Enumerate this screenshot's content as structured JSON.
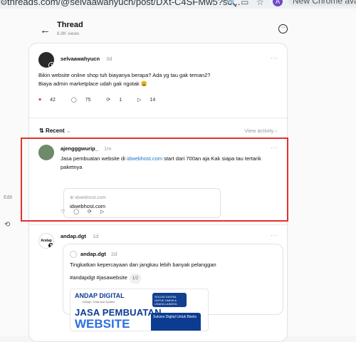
{
  "browser": {
    "url": "threads.com/@selvaawahyucn/post/DXt-C4SFMw5?so...",
    "profile_initial": "A",
    "chrome_chip": "New Chrome ava"
  },
  "sidebar": {
    "edit_label": "Edit"
  },
  "header": {
    "title": "Thread",
    "views": "6.9K views"
  },
  "main_post": {
    "username": "selvaawahyucn",
    "time": "3d",
    "line1": "Bikin website online shop tuh biayanya berapa? Ada yg tau gak teman2?",
    "line2": "Biaya admin marketplace udah gak ngotak 😩",
    "likes": "42",
    "replies": "75",
    "reposts": "1",
    "shares": "14"
  },
  "sort": {
    "label": "Recent",
    "view_activity": "View activity"
  },
  "reply_1": {
    "username": "ajengggwurip_",
    "time": "1m",
    "text_before": "Jasa pembuatan website di ",
    "link_text": "idwebhost.com",
    "text_after": " start dari 700an aja Kak siapa tau tertarik paketnya",
    "link_card_domain": "idwebhost.com",
    "link_card_title": "idwebhost.com"
  },
  "reply_2": {
    "username": "andap.dgt",
    "time": "1d",
    "avatar_text": "Andap",
    "embed_username": "andap.dgt",
    "embed_time": "2d",
    "embed_text": "Tingkatkan kepercayaan dan jangkau lebih banyak pelanggan",
    "hashtags": "#andapdgt #jasawebsite",
    "page_indicator": "1/2",
    "ad_brand": "ANDAP DIGITAL",
    "ad_sub": "Design, Data and System",
    "ad_headline_1": "JASA PEMBUATAN",
    "ad_headline_2": "WEBSITE",
    "ad_badge": "SOLUSI DIGITAL UNTUK UMKM & USAHA LAINNYA",
    "ad_mock": "Sukses Digital Untuk Bisnis"
  },
  "colors": {
    "accent_link": "#1a75c8",
    "highlight_box": "#e4302b",
    "heart": "#e0245e"
  }
}
